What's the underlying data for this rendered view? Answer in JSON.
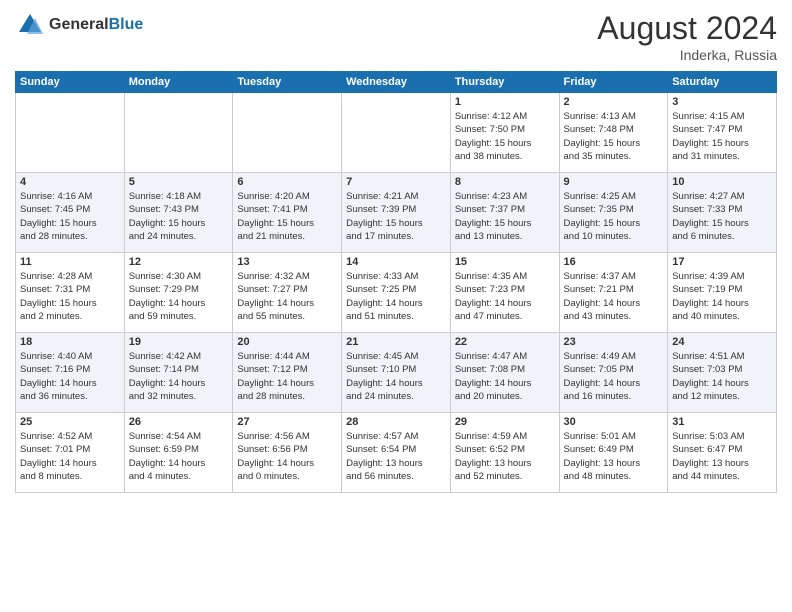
{
  "logo": {
    "text1": "General",
    "text2": "Blue"
  },
  "title": "August 2024",
  "location": "Inderka, Russia",
  "weekdays": [
    "Sunday",
    "Monday",
    "Tuesday",
    "Wednesday",
    "Thursday",
    "Friday",
    "Saturday"
  ],
  "weeks": [
    [
      {
        "day": "",
        "info": ""
      },
      {
        "day": "",
        "info": ""
      },
      {
        "day": "",
        "info": ""
      },
      {
        "day": "",
        "info": ""
      },
      {
        "day": "1",
        "info": "Sunrise: 4:12 AM\nSunset: 7:50 PM\nDaylight: 15 hours\nand 38 minutes."
      },
      {
        "day": "2",
        "info": "Sunrise: 4:13 AM\nSunset: 7:48 PM\nDaylight: 15 hours\nand 35 minutes."
      },
      {
        "day": "3",
        "info": "Sunrise: 4:15 AM\nSunset: 7:47 PM\nDaylight: 15 hours\nand 31 minutes."
      }
    ],
    [
      {
        "day": "4",
        "info": "Sunrise: 4:16 AM\nSunset: 7:45 PM\nDaylight: 15 hours\nand 28 minutes."
      },
      {
        "day": "5",
        "info": "Sunrise: 4:18 AM\nSunset: 7:43 PM\nDaylight: 15 hours\nand 24 minutes."
      },
      {
        "day": "6",
        "info": "Sunrise: 4:20 AM\nSunset: 7:41 PM\nDaylight: 15 hours\nand 21 minutes."
      },
      {
        "day": "7",
        "info": "Sunrise: 4:21 AM\nSunset: 7:39 PM\nDaylight: 15 hours\nand 17 minutes."
      },
      {
        "day": "8",
        "info": "Sunrise: 4:23 AM\nSunset: 7:37 PM\nDaylight: 15 hours\nand 13 minutes."
      },
      {
        "day": "9",
        "info": "Sunrise: 4:25 AM\nSunset: 7:35 PM\nDaylight: 15 hours\nand 10 minutes."
      },
      {
        "day": "10",
        "info": "Sunrise: 4:27 AM\nSunset: 7:33 PM\nDaylight: 15 hours\nand 6 minutes."
      }
    ],
    [
      {
        "day": "11",
        "info": "Sunrise: 4:28 AM\nSunset: 7:31 PM\nDaylight: 15 hours\nand 2 minutes."
      },
      {
        "day": "12",
        "info": "Sunrise: 4:30 AM\nSunset: 7:29 PM\nDaylight: 14 hours\nand 59 minutes."
      },
      {
        "day": "13",
        "info": "Sunrise: 4:32 AM\nSunset: 7:27 PM\nDaylight: 14 hours\nand 55 minutes."
      },
      {
        "day": "14",
        "info": "Sunrise: 4:33 AM\nSunset: 7:25 PM\nDaylight: 14 hours\nand 51 minutes."
      },
      {
        "day": "15",
        "info": "Sunrise: 4:35 AM\nSunset: 7:23 PM\nDaylight: 14 hours\nand 47 minutes."
      },
      {
        "day": "16",
        "info": "Sunrise: 4:37 AM\nSunset: 7:21 PM\nDaylight: 14 hours\nand 43 minutes."
      },
      {
        "day": "17",
        "info": "Sunrise: 4:39 AM\nSunset: 7:19 PM\nDaylight: 14 hours\nand 40 minutes."
      }
    ],
    [
      {
        "day": "18",
        "info": "Sunrise: 4:40 AM\nSunset: 7:16 PM\nDaylight: 14 hours\nand 36 minutes."
      },
      {
        "day": "19",
        "info": "Sunrise: 4:42 AM\nSunset: 7:14 PM\nDaylight: 14 hours\nand 32 minutes."
      },
      {
        "day": "20",
        "info": "Sunrise: 4:44 AM\nSunset: 7:12 PM\nDaylight: 14 hours\nand 28 minutes."
      },
      {
        "day": "21",
        "info": "Sunrise: 4:45 AM\nSunset: 7:10 PM\nDaylight: 14 hours\nand 24 minutes."
      },
      {
        "day": "22",
        "info": "Sunrise: 4:47 AM\nSunset: 7:08 PM\nDaylight: 14 hours\nand 20 minutes."
      },
      {
        "day": "23",
        "info": "Sunrise: 4:49 AM\nSunset: 7:05 PM\nDaylight: 14 hours\nand 16 minutes."
      },
      {
        "day": "24",
        "info": "Sunrise: 4:51 AM\nSunset: 7:03 PM\nDaylight: 14 hours\nand 12 minutes."
      }
    ],
    [
      {
        "day": "25",
        "info": "Sunrise: 4:52 AM\nSunset: 7:01 PM\nDaylight: 14 hours\nand 8 minutes."
      },
      {
        "day": "26",
        "info": "Sunrise: 4:54 AM\nSunset: 6:59 PM\nDaylight: 14 hours\nand 4 minutes."
      },
      {
        "day": "27",
        "info": "Sunrise: 4:56 AM\nSunset: 6:56 PM\nDaylight: 14 hours\nand 0 minutes."
      },
      {
        "day": "28",
        "info": "Sunrise: 4:57 AM\nSunset: 6:54 PM\nDaylight: 13 hours\nand 56 minutes."
      },
      {
        "day": "29",
        "info": "Sunrise: 4:59 AM\nSunset: 6:52 PM\nDaylight: 13 hours\nand 52 minutes."
      },
      {
        "day": "30",
        "info": "Sunrise: 5:01 AM\nSunset: 6:49 PM\nDaylight: 13 hours\nand 48 minutes."
      },
      {
        "day": "31",
        "info": "Sunrise: 5:03 AM\nSunset: 6:47 PM\nDaylight: 13 hours\nand 44 minutes."
      }
    ]
  ]
}
